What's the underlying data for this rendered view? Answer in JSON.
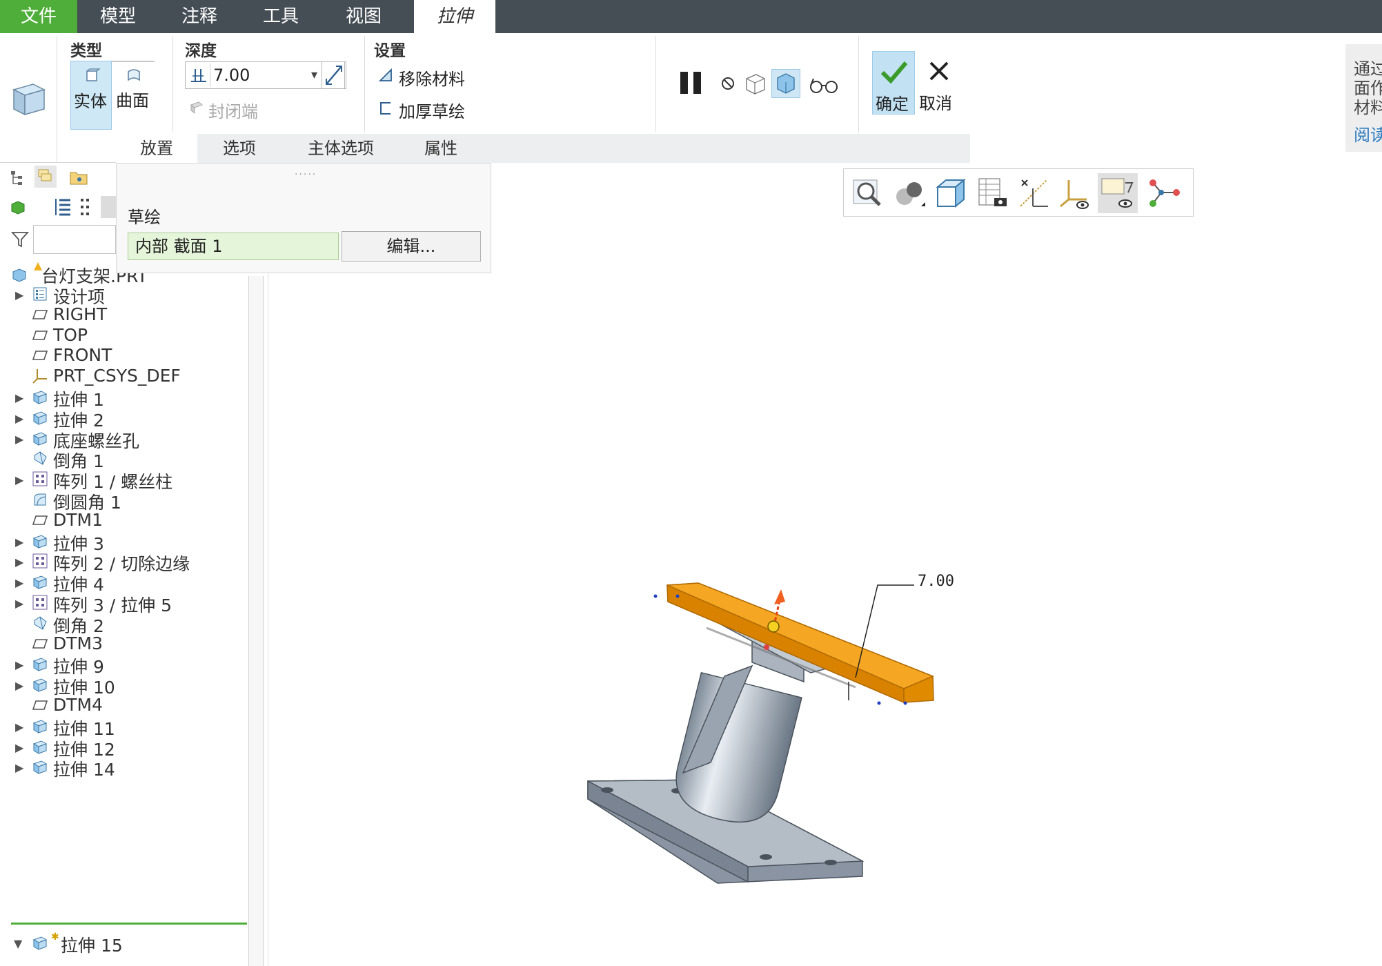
{
  "menu": {
    "file": "文件",
    "model": "模型",
    "annotate": "注释",
    "tools": "工具",
    "view": "视图",
    "extrude": "拉伸"
  },
  "ribbon": {
    "type_title": "类型",
    "solid": "实体",
    "surface": "曲面",
    "depth_title": "深度",
    "depth_value": "7.00",
    "capped_ends": "封闭端",
    "settings_title": "设置",
    "remove_material": "移除材料",
    "thicken_sketch": "加厚草绘",
    "ok": "确定",
    "cancel": "取消"
  },
  "subtabs": [
    "放置",
    "选项",
    "主体选项",
    "属性"
  ],
  "placement": {
    "sketch_label": "草绘",
    "sketch_value": "内部 截面 1",
    "edit_button": "编辑..."
  },
  "help": {
    "lines": [
      "通过",
      "面作",
      "材料"
    ],
    "link": "阅读"
  },
  "tree": {
    "root": "台灯支架.PRT",
    "items": [
      {
        "label": "设计项",
        "icon": "design-items-icon",
        "expand": true
      },
      {
        "label": "RIGHT",
        "icon": "datum-plane-icon",
        "expand": false
      },
      {
        "label": "TOP",
        "icon": "datum-plane-icon",
        "expand": false
      },
      {
        "label": "FRONT",
        "icon": "datum-plane-icon",
        "expand": false
      },
      {
        "label": "PRT_CSYS_DEF",
        "icon": "csys-icon",
        "expand": false
      },
      {
        "label": "拉伸 1",
        "icon": "extrude-icon",
        "expand": true
      },
      {
        "label": "拉伸 2",
        "icon": "extrude-icon",
        "expand": true
      },
      {
        "label": "底座螺丝孔",
        "icon": "extrude-icon",
        "expand": true
      },
      {
        "label": "倒角 1",
        "icon": "chamfer-icon",
        "expand": false
      },
      {
        "label": "阵列 1 / 螺丝柱",
        "icon": "pattern-icon",
        "expand": true
      },
      {
        "label": "倒圆角 1",
        "icon": "round-icon",
        "expand": false
      },
      {
        "label": "DTM1",
        "icon": "datum-plane-icon",
        "expand": false
      },
      {
        "label": "拉伸 3",
        "icon": "extrude-icon",
        "expand": true
      },
      {
        "label": "阵列 2 / 切除边缘",
        "icon": "pattern-icon",
        "expand": true
      },
      {
        "label": "拉伸 4",
        "icon": "extrude-icon",
        "expand": true
      },
      {
        "label": "阵列 3 / 拉伸 5",
        "icon": "pattern-icon",
        "expand": true
      },
      {
        "label": "倒角 2",
        "icon": "chamfer-icon",
        "expand": false
      },
      {
        "label": "DTM3",
        "icon": "datum-plane-icon",
        "expand": false
      },
      {
        "label": "拉伸 9",
        "icon": "extrude-icon",
        "expand": true
      },
      {
        "label": "拉伸 10",
        "icon": "extrude-icon",
        "expand": true
      },
      {
        "label": "DTM4",
        "icon": "datum-plane-icon",
        "expand": false
      },
      {
        "label": "拉伸 11",
        "icon": "extrude-icon",
        "expand": true
      },
      {
        "label": "拉伸 12",
        "icon": "extrude-icon",
        "expand": true
      },
      {
        "label": "拉伸 14",
        "icon": "extrude-icon",
        "expand": true
      }
    ],
    "active_item": "拉伸 15"
  },
  "viewport": {
    "dimension_label": "7.00"
  },
  "colors": {
    "menu_bar": "#454d55",
    "file_tab": "#4fae39",
    "selection_orange": "#f0a010",
    "model_gray": "#9aa4b0"
  }
}
